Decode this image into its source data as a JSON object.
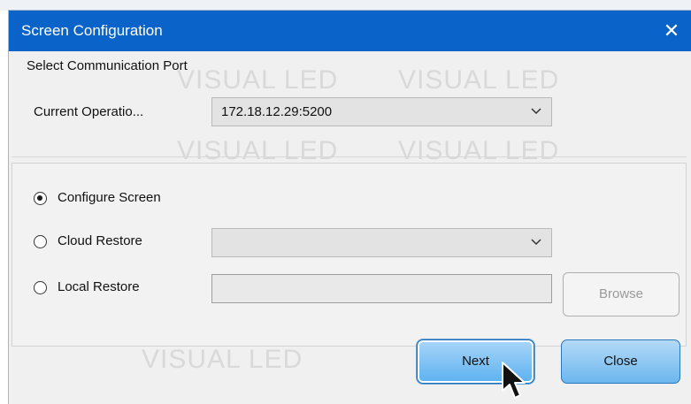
{
  "window": {
    "title": "Screen Configuration",
    "close_glyph": "✕"
  },
  "port_section": {
    "label": "Select Communication Port",
    "current_label": "Current Operatio...",
    "current_value": "172.18.12.29:5200"
  },
  "options": {
    "configure_screen": "Configure Screen",
    "cloud_restore": "Cloud Restore",
    "local_restore": "Local Restore",
    "selected": "configure_screen",
    "cloud_value": "",
    "local_path": ""
  },
  "buttons": {
    "browse": "Browse",
    "next": "Next",
    "close": "Close"
  },
  "watermark": {
    "text": "VISUAL LED"
  },
  "icons": {
    "close": "close-icon",
    "dropdown": "chevron-down-icon",
    "cursor": "mouse-pointer-icon"
  },
  "colors": {
    "titlebar": "#0a63c9",
    "button_blue": "#5cb1f0",
    "dialog_bg": "#f0f0f0"
  }
}
